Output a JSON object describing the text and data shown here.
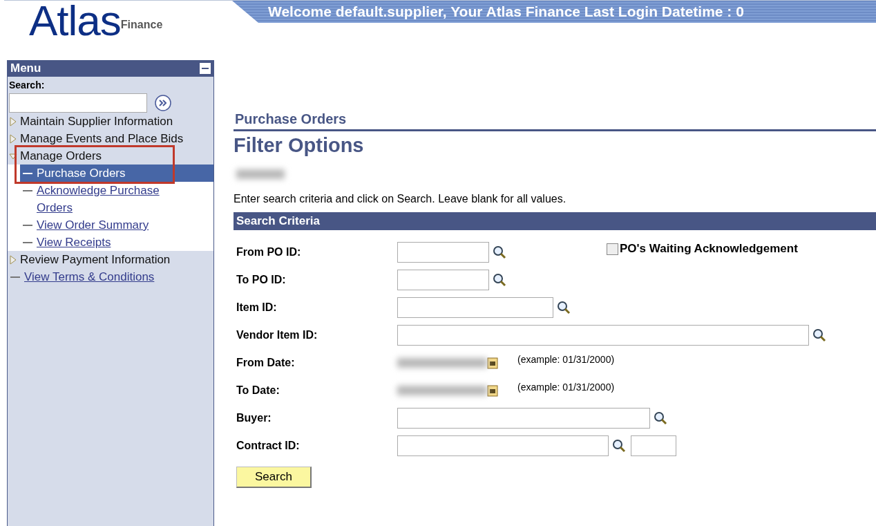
{
  "header": {
    "logo": {
      "main": "Atlas",
      "sub": "Finance"
    },
    "banner": "Welcome default.supplier, Your Atlas Finance Last Login Datetime : 0"
  },
  "sidebar": {
    "title": "Menu",
    "search_label": "Search:",
    "items": [
      {
        "kind": "folder",
        "label": "Maintain Supplier Information",
        "expanded": false
      },
      {
        "kind": "folder",
        "label": "Manage Events and Place Bids",
        "expanded": false
      },
      {
        "kind": "folder",
        "label": "Manage Orders",
        "expanded": true,
        "children": [
          {
            "kind": "link",
            "label": "Purchase Orders",
            "selected": true
          },
          {
            "kind": "link",
            "label": "Acknowledge Purchase Orders",
            "selected": false
          },
          {
            "kind": "link",
            "label": "View Order Summary",
            "selected": false
          },
          {
            "kind": "link",
            "label": "View Receipts",
            "selected": false
          }
        ]
      },
      {
        "kind": "folder",
        "label": "Review Payment Information",
        "expanded": false
      },
      {
        "kind": "link",
        "label": "View Terms & Conditions",
        "selected": false
      }
    ]
  },
  "page": {
    "breadcrumb": "Purchase Orders",
    "title": "Filter Options",
    "instructions": "Enter search criteria and click on Search. Leave blank for all values.",
    "section": "Search Criteria",
    "checkbox": {
      "label": "PO's Waiting Acknowledgement",
      "checked": false
    },
    "fields": [
      {
        "kind": "lookup",
        "label": "From PO ID:"
      },
      {
        "kind": "lookup",
        "label": "To PO ID:"
      },
      {
        "kind": "lookup",
        "label": "Item ID:"
      },
      {
        "kind": "lookup",
        "label": "Vendor Item ID:"
      },
      {
        "kind": "date",
        "label": "From Date:",
        "example": "(example: 01/31/2000)"
      },
      {
        "kind": "date",
        "label": "To Date:",
        "example": "(example: 01/31/2000)"
      },
      {
        "kind": "lookup",
        "label": "Buyer:"
      },
      {
        "kind": "contract",
        "label": "Contract ID:"
      }
    ],
    "button": "Search"
  }
}
